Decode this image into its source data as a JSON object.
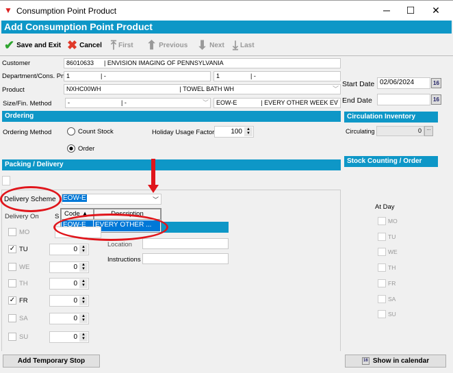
{
  "window": {
    "title": "Consumption Point Product",
    "minimize": "─",
    "maximize": "☐",
    "close": "✕"
  },
  "header": {
    "title": "Add Consumption Point Product"
  },
  "toolbar": {
    "save": "Save and Exit",
    "cancel": "Cancel",
    "first": "First",
    "previous": "Previous",
    "next": "Next",
    "last": "Last"
  },
  "form": {
    "customer_label": "Customer",
    "customer_value": "86010633      | ENVISION IMAGING OF PENNSYLVANIA",
    "dept_label": "Department/Cons. Pnt",
    "dept_value": "1                  | -",
    "cons_value": "1                  | -",
    "product_label": "Product",
    "product_value": "NXHC00WH                                              | TOWEL BATH WH",
    "size_label": "Size/Fin. Method",
    "size_value": "-                              | -",
    "fin_value": "EOW-E              | EVERY OTHER WEEK EV",
    "start_label": "Start Date",
    "start_value": "02/06/2024",
    "end_label": "End Date",
    "end_value": "",
    "cal_icon": "16"
  },
  "ordering": {
    "title": "Ordering",
    "method_label": "Ordering Method",
    "count_stock": "Count Stock",
    "order": "Order",
    "selected": "Order",
    "holiday_label": "Holiday Usage Factor",
    "holiday_value": "100"
  },
  "circulation": {
    "title": "Circulation Inventory",
    "circulating_label": "Circulating",
    "circulating_value": "0",
    "more": "..."
  },
  "stock": {
    "title": "Stock Counting / Order",
    "at_day": "At Day",
    "days": [
      "MO",
      "TU",
      "WE",
      "TH",
      "FR",
      "SA",
      "SU"
    ]
  },
  "packing": {
    "title": "Packing / Delivery",
    "scheme_label": "Delivery Scheme",
    "scheme_value": "EOW-E",
    "delivery_on": "Delivery On",
    "s_label": "S",
    "location_label": "Location",
    "instructions_label": "Instructions",
    "dropdown": {
      "col_code": "Code",
      "col_desc": "Description",
      "row_code": "EOW-E",
      "row_desc": "EVERY OTHER ..."
    },
    "days": [
      {
        "d": "MO",
        "checked": false,
        "v": ""
      },
      {
        "d": "TU",
        "checked": true,
        "v": "0"
      },
      {
        "d": "WE",
        "checked": false,
        "v": "0"
      },
      {
        "d": "TH",
        "checked": false,
        "v": "0"
      },
      {
        "d": "FR",
        "checked": true,
        "v": "0"
      },
      {
        "d": "SA",
        "checked": false,
        "v": "0"
      },
      {
        "d": "SU",
        "checked": false,
        "v": "0"
      }
    ]
  },
  "buttons": {
    "add_stop": "Add Temporary Stop",
    "calendar": "Show in calendar"
  },
  "colors": {
    "accent": "#0e97c7",
    "annotation": "#e0151b"
  }
}
